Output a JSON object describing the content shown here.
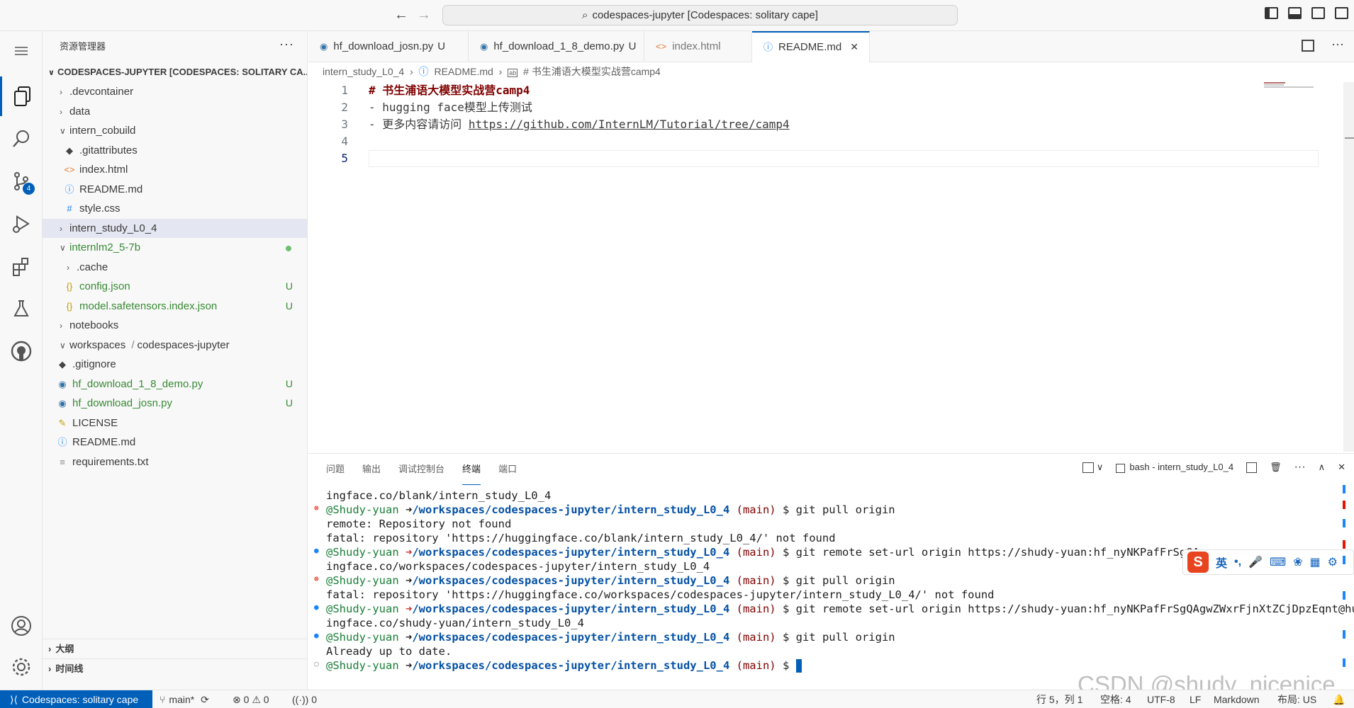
{
  "window": {
    "title": "codespaces-jupyter [Codespaces: solitary cape]"
  },
  "activity": {
    "scm_badge": "4"
  },
  "sidebar": {
    "header": "资源管理器",
    "more": "···",
    "workspace": "CODESPACES-JUPYTER [CODESPACES: SOLITARY CA...",
    "items": [
      {
        "label": ".devcontainer"
      },
      {
        "label": "data"
      },
      {
        "label": "intern_cobuild"
      },
      {
        "label": ".gitattributes"
      },
      {
        "label": "index.html"
      },
      {
        "label": "README.md"
      },
      {
        "label": "style.css"
      },
      {
        "label": "intern_study_L0_4"
      },
      {
        "label": "internlm2_5-7b"
      },
      {
        "label": ".cache"
      },
      {
        "label": "config.json",
        "status": "U"
      },
      {
        "label": "model.safetensors.index.json",
        "status": "U"
      },
      {
        "label": "notebooks"
      },
      {
        "label": "workspaces",
        "sep": "/",
        "label2": "codespaces-jupyter"
      },
      {
        "label": ".gitignore"
      },
      {
        "label": "hf_download_1_8_demo.py",
        "status": "U"
      },
      {
        "label": "hf_download_josn.py",
        "status": "U"
      },
      {
        "label": "LICENSE"
      },
      {
        "label": "README.md"
      },
      {
        "label": "requirements.txt"
      }
    ],
    "outline": "大纲",
    "timeline": "时间线"
  },
  "tabs": [
    {
      "label": "hf_download_josn.py",
      "status": "U"
    },
    {
      "label": "hf_download_1_8_demo.py",
      "status": "U"
    },
    {
      "label": "index.html"
    },
    {
      "label": "README.md",
      "close": "✕"
    }
  ],
  "breadcrumb": {
    "folder": "intern_study_L0_4",
    "file": "README.md",
    "symbol": "# 书生浦语大模型实战营camp4"
  },
  "editor": {
    "lines": [
      {
        "num": "1",
        "text": "# 书生浦语大模型实战营camp4"
      },
      {
        "num": "2",
        "text": "- hugging face模型上传测试"
      },
      {
        "num": "3",
        "prefix": "- 更多内容请访问 ",
        "link": "https://github.com/InternLM/Tutorial/tree/camp4"
      },
      {
        "num": "4",
        "text": ""
      },
      {
        "num": "5",
        "text": ""
      }
    ]
  },
  "panel": {
    "tabs": [
      "问题",
      "输出",
      "调试控制台",
      "终端",
      "端口"
    ],
    "terminal_name": "bash - intern_study_L0_4",
    "terminal": {
      "user": "@Shudy-yuan",
      "path": "/workspaces/codespaces-jupyter/intern_study_L0_4",
      "branch": "(main)",
      "lines": {
        "l0": "ingface.co/blank/intern_study_L0_4",
        "c1": "$ git pull origin",
        "l2": "remote: Repository not found",
        "l3": "fatal: repository 'https://huggingface.co/blank/intern_study_L0_4/' not found",
        "c4": "$ git remote set-url origin https://shudy-yuan:hf_nyNKPafFrSgQAg",
        "l5": "ingface.co/workspaces/codespaces-jupyter/intern_study_L0_4",
        "c6": "$ git pull origin",
        "l7": "fatal: repository 'https://huggingface.co/workspaces/codespaces-jupyter/intern_study_L0_4/' not found",
        "c8": "$ git remote set-url origin https://shudy-yuan: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@hugg",
        "l9": "ingface.co/shudy-yuan/intern_study_L0_4",
        "c10": "$ git pull origin",
        "l11": "Already up to date.",
        "c12": "$"
      }
    }
  },
  "ime": {
    "logo": "S",
    "lang": "英",
    "punct": "•,"
  },
  "watermark": "CSDN @shudy_nicenice",
  "statusbar": {
    "remote": "Codespaces: solitary cape",
    "branch": "main*",
    "errors": "0",
    "warnings": "0",
    "ports": "0",
    "position": "行 5，列 1",
    "spaces": "空格: 4",
    "encoding": "UTF-8",
    "eol": "LF",
    "language": "Markdown",
    "layout": "布局: US"
  },
  "colors": {
    "accent": "#005fb8",
    "heading": "#800000",
    "untracked": "#388a34"
  }
}
